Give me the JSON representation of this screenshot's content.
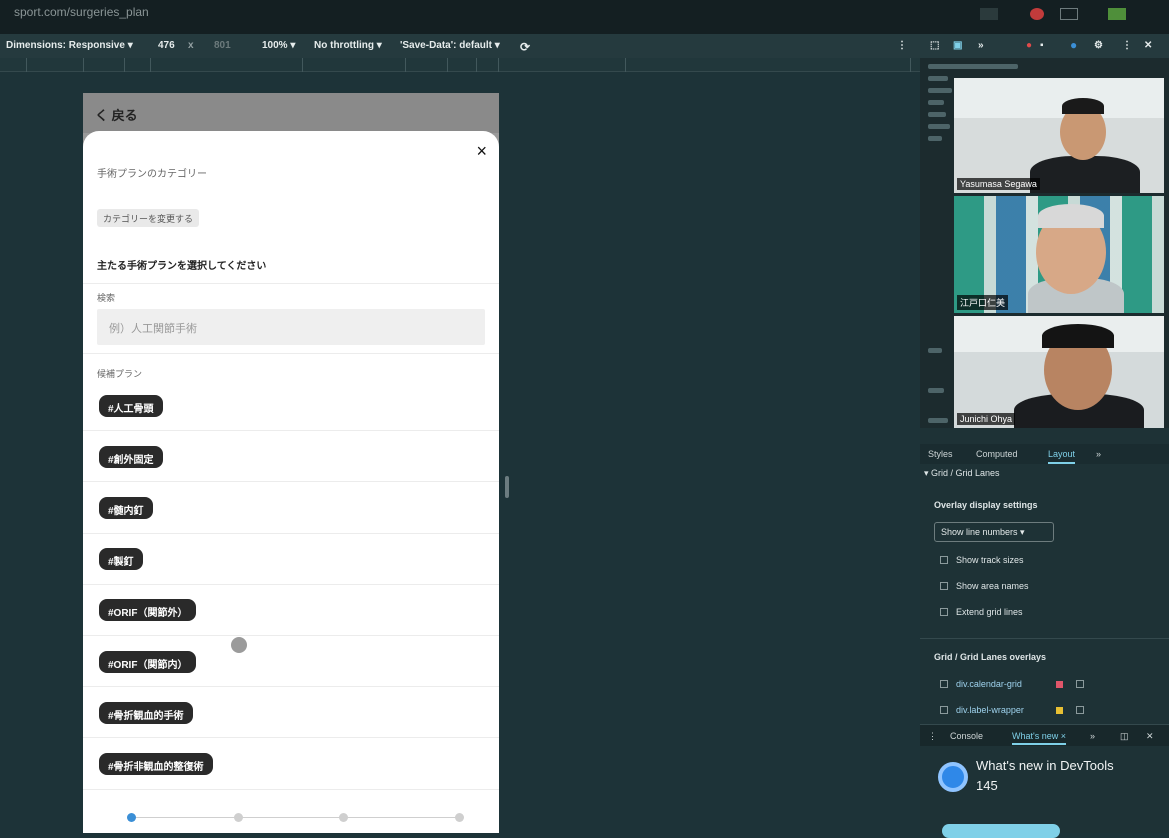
{
  "window": {
    "url": "sport.com/surgeries_plan"
  },
  "toolbar": {
    "dimensions": "Dimensions: Responsive ▾",
    "width": "476",
    "x": "x",
    "height": "801",
    "zoom": "100% ▾",
    "throttle": "No throttling ▾",
    "savedata": "'Save-Data': default ▾"
  },
  "app": {
    "back_label": "く 戻る",
    "close_label": "×",
    "category_title": "手術プランのカテゴリー",
    "category_button": "カテゴリーを変更する",
    "main_prompt": "主たる手術プランを選択してください",
    "search_label": "検索",
    "search_placeholder": "例）人工関節手術",
    "candidate_label": "候補プラン",
    "plans": [
      "#人工骨頭",
      "#創外固定",
      "#髄内釘",
      "#製釘",
      "#ORIF（関節外）",
      "#ORIF（関節内）",
      "#骨折観血的手術",
      "#骨折非観血的整復術"
    ]
  },
  "video_call": {
    "participants": [
      {
        "name": "Yasumasa Segawa"
      },
      {
        "name": "江戸口仁美"
      },
      {
        "name": "Junichi Ohya"
      }
    ]
  },
  "devtools": {
    "tabs": [
      "Styles",
      "Computed",
      "Layout",
      "»"
    ],
    "active_tab": "Layout",
    "section_grid": "▾ Grid / Grid Lanes",
    "overlay_heading": "Overlay display settings",
    "line_numbers_select": "Show line numbers ▾",
    "checkboxes": [
      "Show track sizes",
      "Show area names",
      "Extend grid lines"
    ],
    "overlays_heading": "Grid / Grid Lanes overlays",
    "overlays": [
      {
        "label": "div.calendar-grid",
        "color": "#e0566a"
      },
      {
        "label": "div.label-wrapper",
        "color": "#e8c033"
      }
    ],
    "console_tabs": [
      "Console",
      "What's new ×",
      "»"
    ],
    "whatsnew_title": "What's new in DevTools",
    "whatsnew_version": "145"
  },
  "colors": {
    "accent": "#3b8fd6",
    "chip_bg": "#2a2a2a"
  }
}
